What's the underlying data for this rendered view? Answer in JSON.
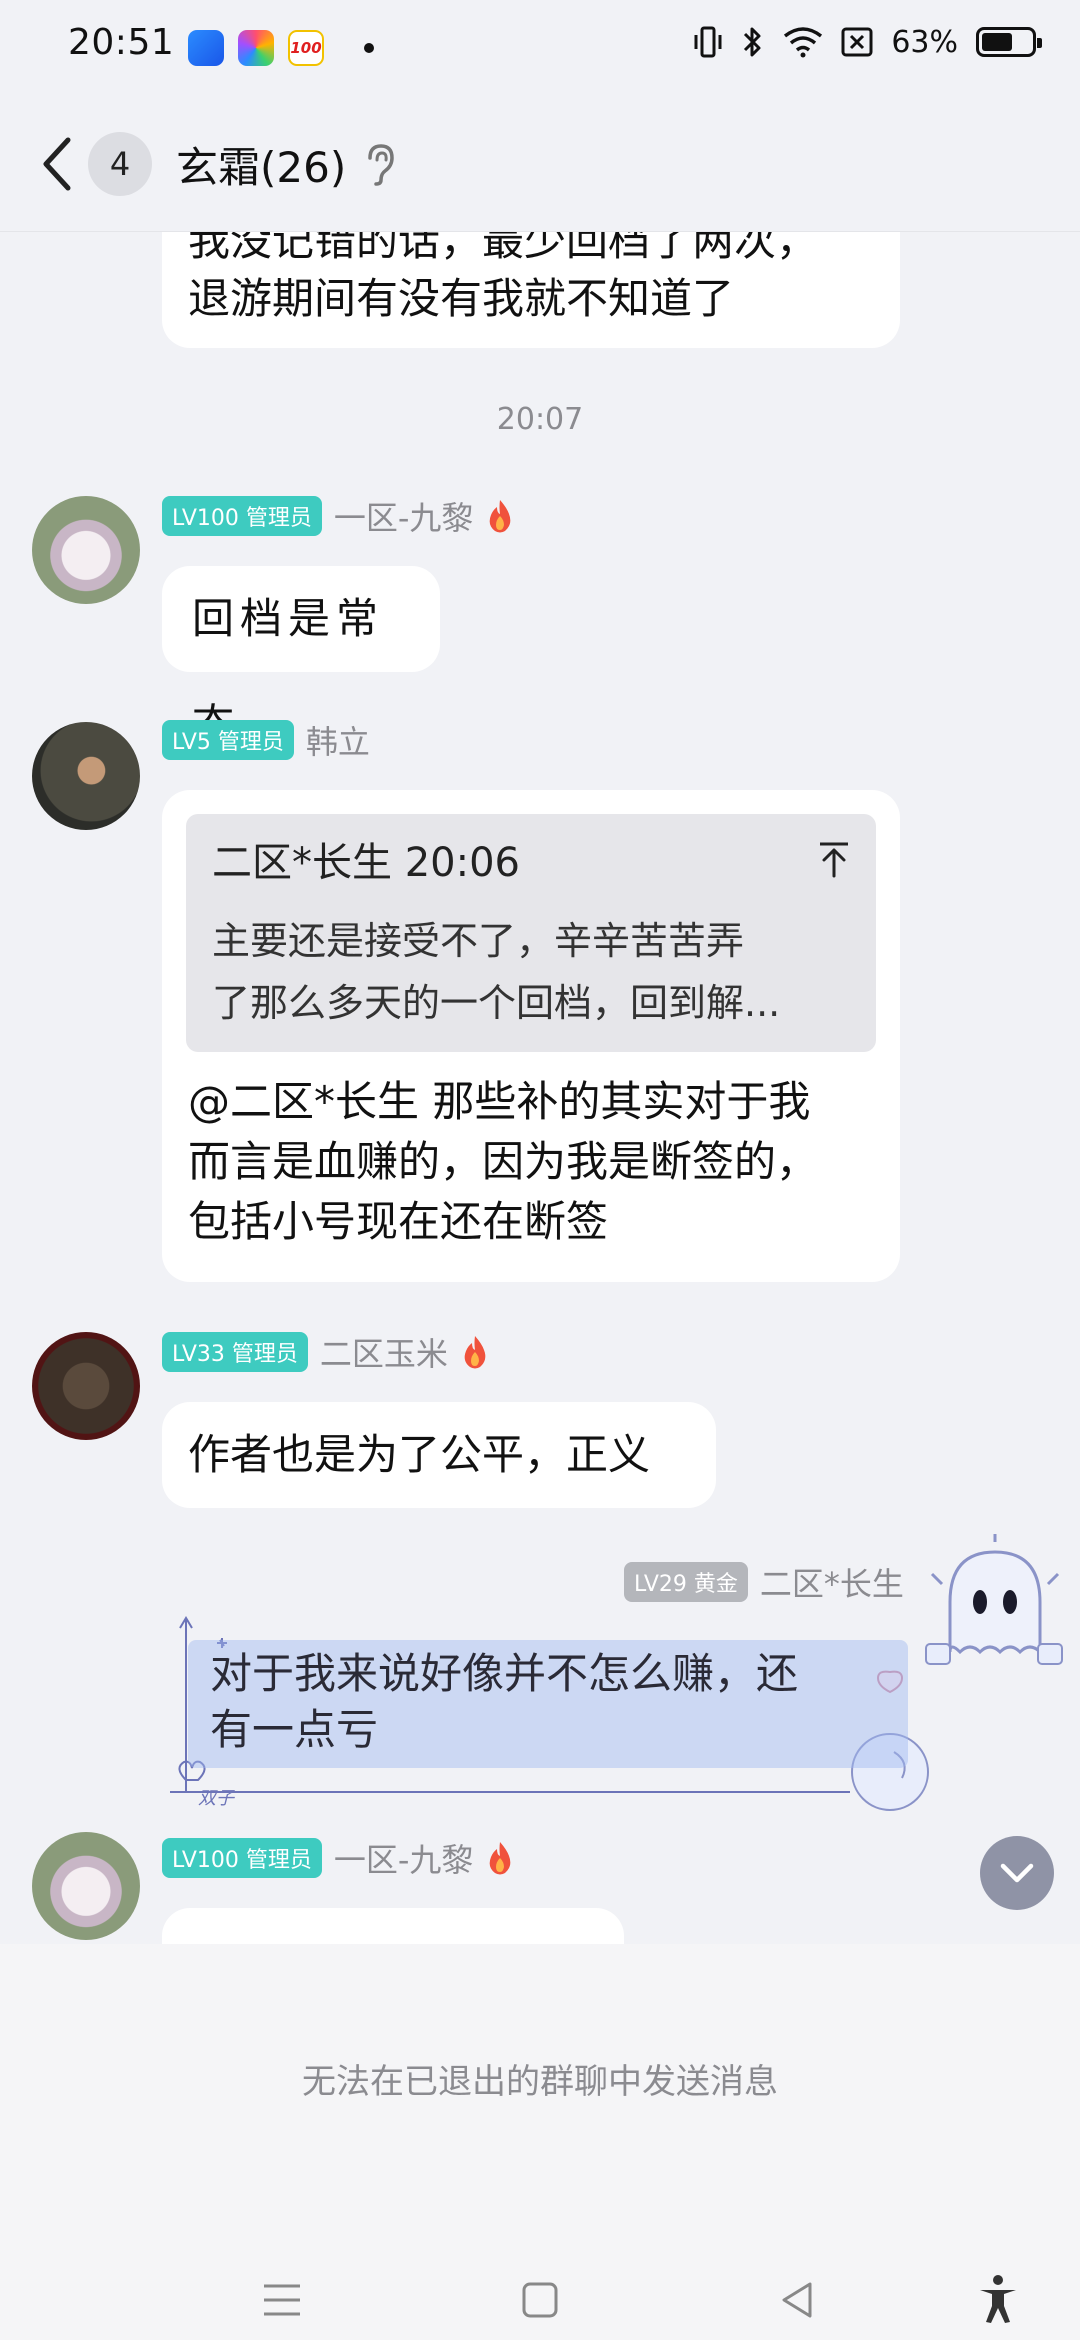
{
  "status_bar": {
    "time": "20:51",
    "battery_percent": "63%",
    "battery_level": 0.63,
    "app_icons": [
      "blue-app-icon",
      "colorful-app-icon",
      "100-app-icon"
    ],
    "icons": [
      "vibrate-icon",
      "bluetooth-icon",
      "wifi-icon",
      "sim-off-icon",
      "battery-icon"
    ]
  },
  "header": {
    "unread_count": "4",
    "title": "玄霜(26)",
    "ear_icon": "ear-icon"
  },
  "messages": {
    "m0": {
      "text": "我没记错的话，最少回档了两次，\n退游期间有没有我就不知道了"
    },
    "time_sep": "20:07",
    "m1": {
      "badge": "LV100 管理员",
      "sender": "一区-九黎",
      "text": "回档是常态"
    },
    "m2": {
      "badge": "LV5 管理员",
      "sender": "韩立",
      "quote_head": "二区*长生 20:06",
      "quote_text": "主要还是接受不了，辛辛苦苦弄\n了那么多天的一个回档，回到解...",
      "text": "@二区*长生 那些补的其实对于我\n而言是血赚的，因为我是断签的，\n包括小号现在还在断签"
    },
    "m3": {
      "badge": "LV33 管理员",
      "sender": "二区玉米",
      "text": "作者也是为了公平，正义"
    },
    "m4": {
      "badge": "LV29 黄金",
      "sender": "二区*长生",
      "text": "对于我来说好像并不怎么赚，还\n有一点亏",
      "sticker_label": "双子"
    },
    "m5": {
      "badge": "LV100 管理员",
      "sender": "一区-九黎"
    }
  },
  "bottom": {
    "notice": "无法在已退出的群聊中发送消息",
    "nav": [
      "menu-icon",
      "home-icon",
      "back-icon",
      "accessibility-icon"
    ]
  },
  "colors": {
    "background": "#f1f2f6",
    "badge_admin": "#3ecbc0",
    "badge_gold": "#b4b6bb",
    "bubble": "#ffffff",
    "sticker_highlight": "#a0b9f0"
  }
}
